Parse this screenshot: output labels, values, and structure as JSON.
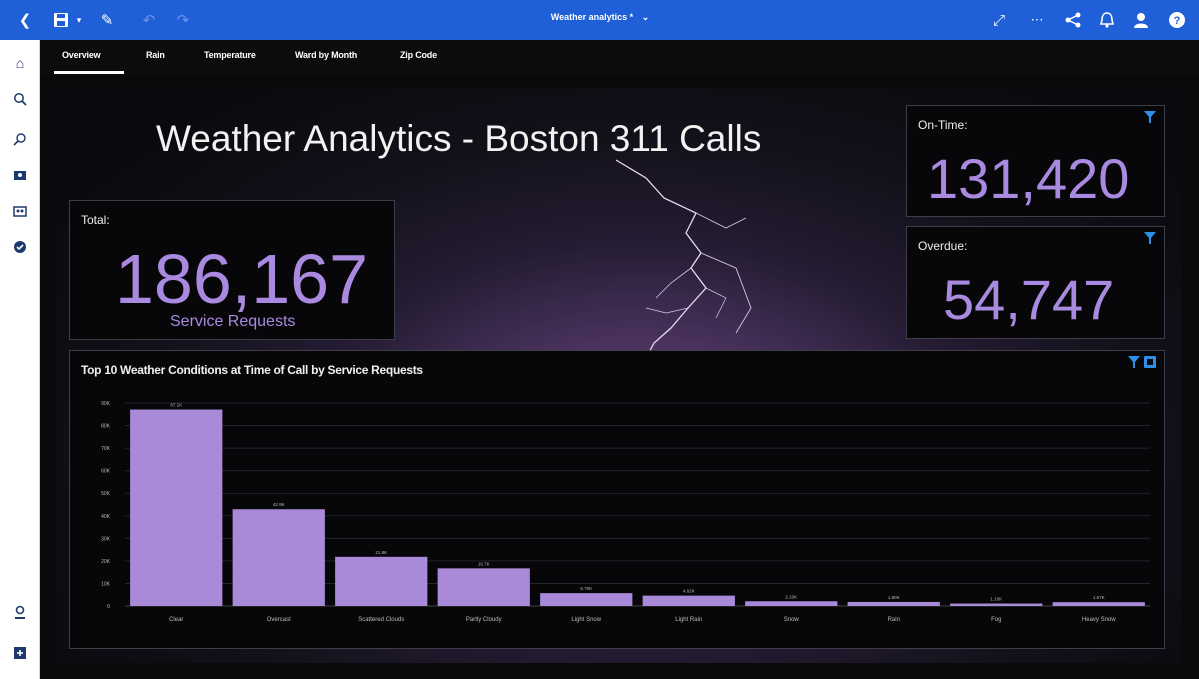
{
  "app": {
    "title": "Weather analytics *",
    "icons": {
      "back": "collapse-icon",
      "save": "save-icon",
      "edit": "pencil-icon",
      "undo": "undo-icon",
      "redo": "redo-icon",
      "chevron": "chevron-down-icon",
      "expand": "expand-icon",
      "more": "more-icon",
      "share": "share-icon",
      "notifications": "bell-icon",
      "user": "user-icon",
      "help": "help-icon"
    }
  },
  "sidebar": {
    "items": [
      {
        "name": "home-icon"
      },
      {
        "name": "search-icon"
      },
      {
        "name": "assistant-icon"
      },
      {
        "name": "my-content-icon"
      },
      {
        "name": "team-content-icon"
      },
      {
        "name": "recent-icon"
      },
      {
        "name": "manage-icon"
      },
      {
        "name": "new-icon"
      }
    ]
  },
  "tabs": [
    {
      "label": "Overview",
      "active": true
    },
    {
      "label": "Rain"
    },
    {
      "label": "Temperature"
    },
    {
      "label": "Ward by Month"
    },
    {
      "label": "Zip Code"
    }
  ],
  "dashboard": {
    "headline": "Weather Analytics - Boston 311 Calls",
    "total": {
      "label": "Total:",
      "value": "186,167",
      "sub": "Service Requests"
    },
    "on_time": {
      "label": "On-Time:",
      "value": "131,420"
    },
    "overdue": {
      "label": "Overdue:",
      "value": "54,747"
    },
    "chart_title": "Top 10 Weather Conditions at Time of Call by Service Requests",
    "colors": {
      "accent": "#a98ae0",
      "bar": "#a98ad8",
      "filter": "#2f8fe8"
    }
  },
  "chart_data": {
    "type": "bar",
    "title": "Top 10 Weather Conditions at Time of Call by Service Requests",
    "categories": [
      "Clear",
      "Overcast",
      "Scattered Clouds",
      "Partly Cloudy",
      "Light Snow",
      "Light Rain",
      "Snow",
      "Rain",
      "Fog",
      "Heavy Snow"
    ],
    "values": [
      87100,
      42900,
      21800,
      16700,
      5700,
      4600,
      2100,
      1800,
      1100,
      1700
    ],
    "value_labels": [
      "87.1K",
      "42.9K",
      "21.8K",
      "16.7K",
      "5.70K",
      "4.62K",
      "2.10K",
      "1.80K",
      "1.10K",
      "1.67K"
    ],
    "yticks": [
      "90K",
      "80K",
      "70K",
      "60K",
      "50K",
      "40K",
      "30K",
      "20K",
      "10K",
      "0"
    ],
    "ylim": [
      0,
      90000
    ],
    "grid": true
  }
}
